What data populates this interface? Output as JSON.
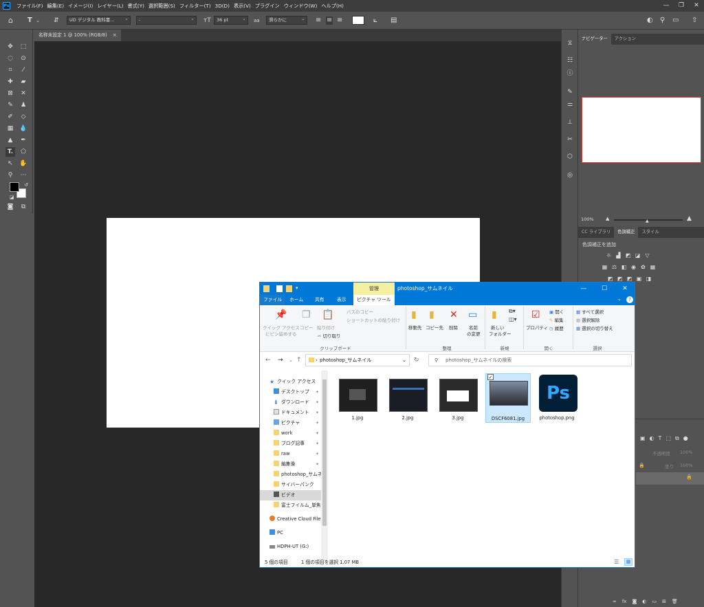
{
  "photoshop": {
    "logo": "Ps",
    "menus": [
      "ファイル(F)",
      "編集(E)",
      "イメージ(I)",
      "レイヤー(L)",
      "書式(Y)",
      "選択範囲(S)",
      "フィルター(T)",
      "3D(D)",
      "表示(V)",
      "プラグイン",
      "ウィンドウ(W)",
      "ヘルプ(H)"
    ],
    "window_controls": [
      "—",
      "❐",
      "✕"
    ],
    "options": {
      "font_family": "UD デジタル 教科書...",
      "font_style": "-",
      "font_size": "36 pt",
      "antialias": "滑らかに",
      "aa_label": "aa"
    },
    "document_tab": "名称未設定 1 @ 100% (RGB/8)",
    "document_tab_close": "×",
    "panels": {
      "top_tabs": [
        "ナビゲーター",
        "アクション"
      ],
      "zoom": "100%",
      "mid_tabs": [
        "CC ライブラリ",
        "色調補正",
        "スタイル"
      ],
      "adjust_heading": "色調補正を追加",
      "layers_opacity": "不透明度",
      "layers_fill": "塗り",
      "opacity_value": "100%",
      "fill_value": "100%"
    },
    "canvas_color": "#ffffff"
  },
  "explorer": {
    "manage_tab": "管理",
    "title": "photoshop_サムネイル",
    "ribbon_tabs": [
      "ファイル",
      "ホーム",
      "共有",
      "表示",
      "ピクチャ ツール"
    ],
    "ribbon": {
      "quick_access": "クイック アクセス",
      "pin": "にピン留めする",
      "copy": "コピー",
      "paste": "貼り付け",
      "copy_path": "パスのコピー",
      "paste_shortcut": "ショートカットの貼り付け",
      "cut": "切り取り",
      "clipboard": "クリップボード",
      "move_to": "移動先",
      "copy_to": "コピー先",
      "delete": "削除",
      "rename_1": "名前",
      "rename_2": "の変更",
      "organize": "整理",
      "new_folder_1": "新しい",
      "new_folder_2": "フォルダー",
      "new": "新規",
      "properties": "プロパティ",
      "open": "開く",
      "edit": "編集",
      "history": "履歴",
      "open_group": "開く",
      "select_all": "すべて選択",
      "select_none": "選択解除",
      "invert": "選択の切り替え",
      "select_group": "選択"
    },
    "address": "photoshop_サムネイル",
    "search_placeholder": "photoshop_サムネイルの検索",
    "nav_items": [
      {
        "label": "クイック アクセス",
        "icon": "star-icon"
      },
      {
        "label": "デスクトップ",
        "icon": "desktop-icon"
      },
      {
        "label": "ダウンロード",
        "icon": "download-icon"
      },
      {
        "label": "ドキュメント",
        "icon": "document-icon"
      },
      {
        "label": "ピクチャ",
        "icon": "picture-icon"
      },
      {
        "label": "work",
        "icon": "folder-icon"
      },
      {
        "label": "ブログ記事",
        "icon": "folder-icon"
      },
      {
        "label": "raw",
        "icon": "folder-icon"
      },
      {
        "label": "編集後",
        "icon": "folder-icon"
      },
      {
        "label": "photoshop_サムネ",
        "icon": "folder-icon"
      },
      {
        "label": "サイバーパンク",
        "icon": "folder-icon"
      },
      {
        "label": "ビデオ",
        "icon": "video-icon"
      },
      {
        "label": "富士フイルム_単焦",
        "icon": "folder-icon"
      },
      {
        "label": "Creative Cloud File",
        "icon": "cloud-icon"
      },
      {
        "label": "PC",
        "icon": "pc-icon"
      },
      {
        "label": "HDPH-UT (G:)",
        "icon": "drive-icon"
      }
    ],
    "files": [
      {
        "name": "1.jpg",
        "selected": false
      },
      {
        "name": "2.jpg",
        "selected": false
      },
      {
        "name": "3.jpg",
        "selected": false
      },
      {
        "name": "DSCF6081.jpg",
        "selected": true
      },
      {
        "name": "photoshop.png",
        "selected": false
      }
    ],
    "status": {
      "count": "5 個の項目",
      "selection": "1 個の項目を選択  1.07 MB"
    }
  }
}
